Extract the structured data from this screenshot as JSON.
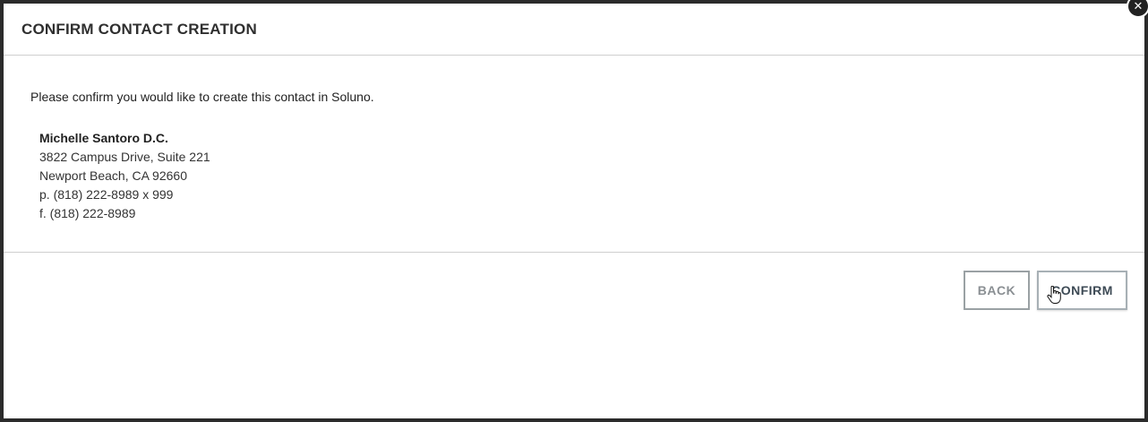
{
  "dialog": {
    "title": "CONFIRM CONTACT CREATION",
    "close_glyph": "✕"
  },
  "body": {
    "intro": "Please confirm you would like to create this contact in Soluno.",
    "contact": {
      "name": "Michelle Santoro D.C.",
      "address_line1": "3822 Campus Drive, Suite 221",
      "address_line2": "Newport Beach, CA 92660",
      "phone": "p. (818) 222-8989 x 999",
      "fax": "f. (818) 222-8989"
    }
  },
  "footer": {
    "back_label": "BACK",
    "confirm_label": "CONFIRM"
  },
  "icons": {
    "close": "close-icon",
    "cursor": "hand-pointer-icon"
  },
  "colors": {
    "title": "#2f2f2f",
    "button_border": "#9aa1a4",
    "button_text": "#8a8f93",
    "confirm_text": "#3d4a55"
  }
}
